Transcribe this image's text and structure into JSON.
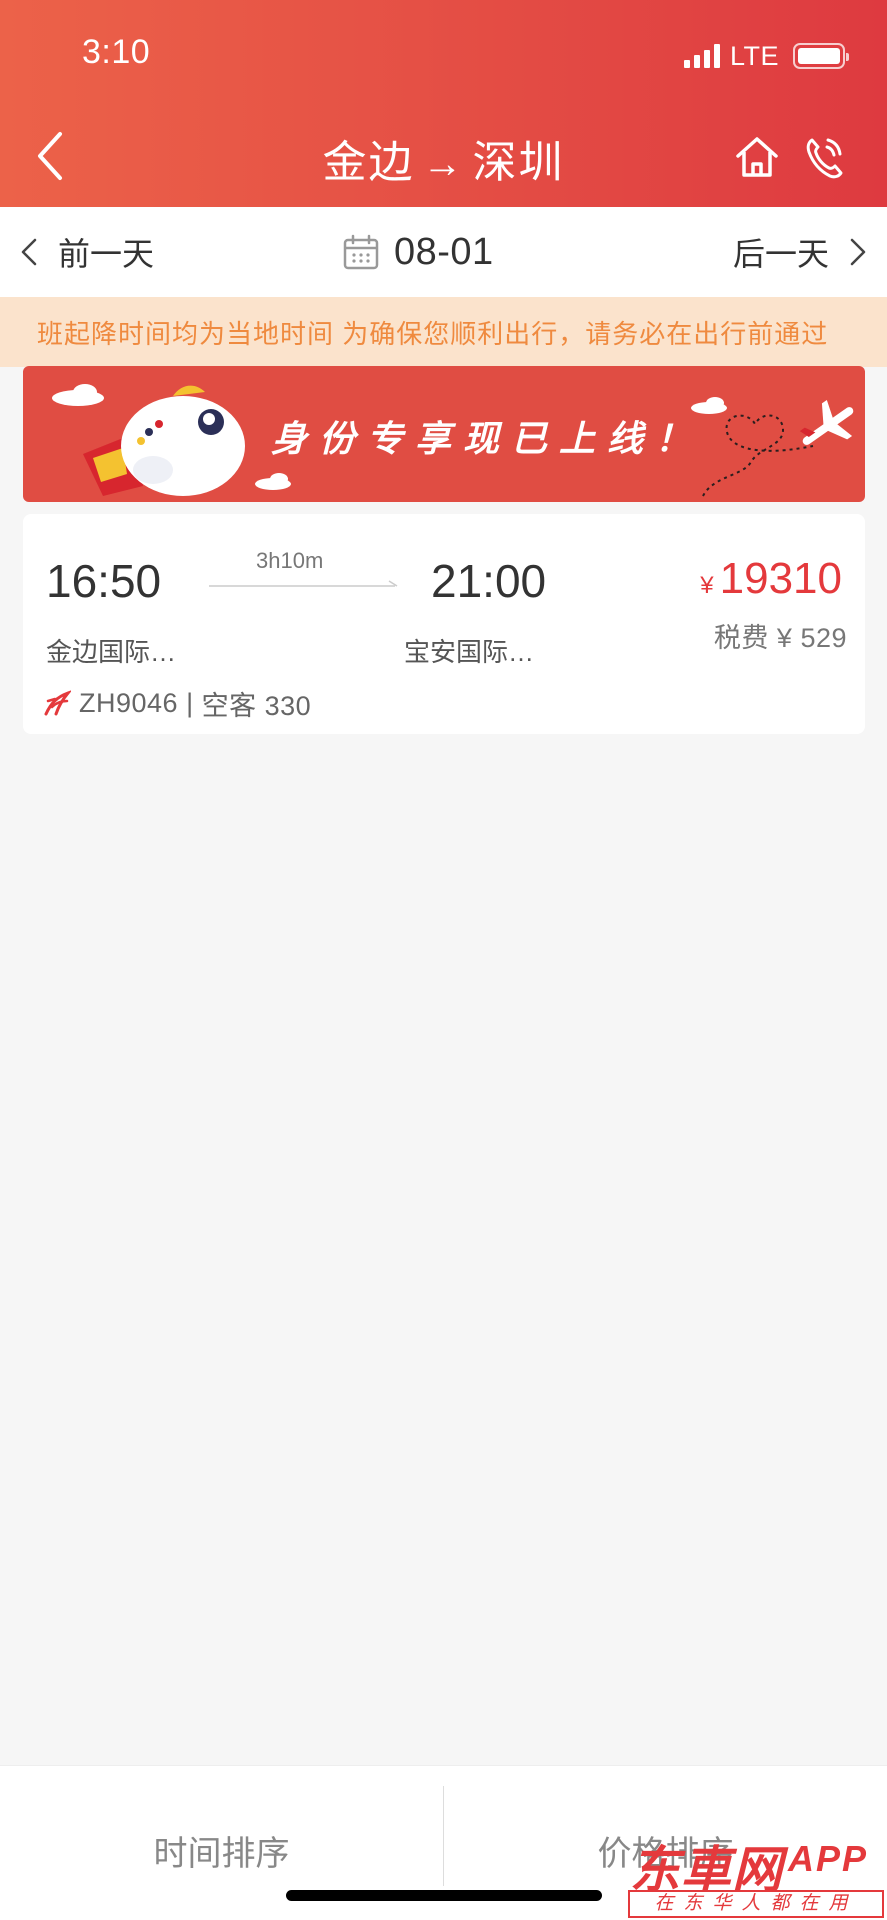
{
  "status_bar": {
    "time": "3:10",
    "network": "LTE"
  },
  "nav": {
    "origin": "金边",
    "arrow": "→",
    "destination": "深圳"
  },
  "date_bar": {
    "prev_label": "前一天",
    "date": "08-01",
    "next_label": "后一天"
  },
  "notice": {
    "text": "班起降时间均为当地时间  为确保您顺利出行，请务必在出行前通过"
  },
  "banner": {
    "text": "身份专享现已上线！"
  },
  "flight": {
    "departure_time": "16:50",
    "arrival_time": "21:00",
    "duration": "3h10m",
    "departure_airport": "金边国际…",
    "arrival_airport": "宝安国际…",
    "currency_symbol": "¥",
    "price": "19310",
    "tax": "税费 ¥ 529",
    "flight_number": "ZH9046",
    "separator": "|",
    "aircraft": "空客 330"
  },
  "bottom_bar": {
    "sort_time_label": "时间排序",
    "sort_price_label": "价格排序"
  },
  "watermark": {
    "main": "东車网",
    "app": "APP",
    "sub": "在东华人都在用"
  },
  "colors": {
    "header_start": "#ec6249",
    "header_end": "#de3a40",
    "price": "#e4393c",
    "notice_bg": "#fbe3cc",
    "notice_text": "#ef8a3f",
    "banner_bg": "#e04d43"
  }
}
